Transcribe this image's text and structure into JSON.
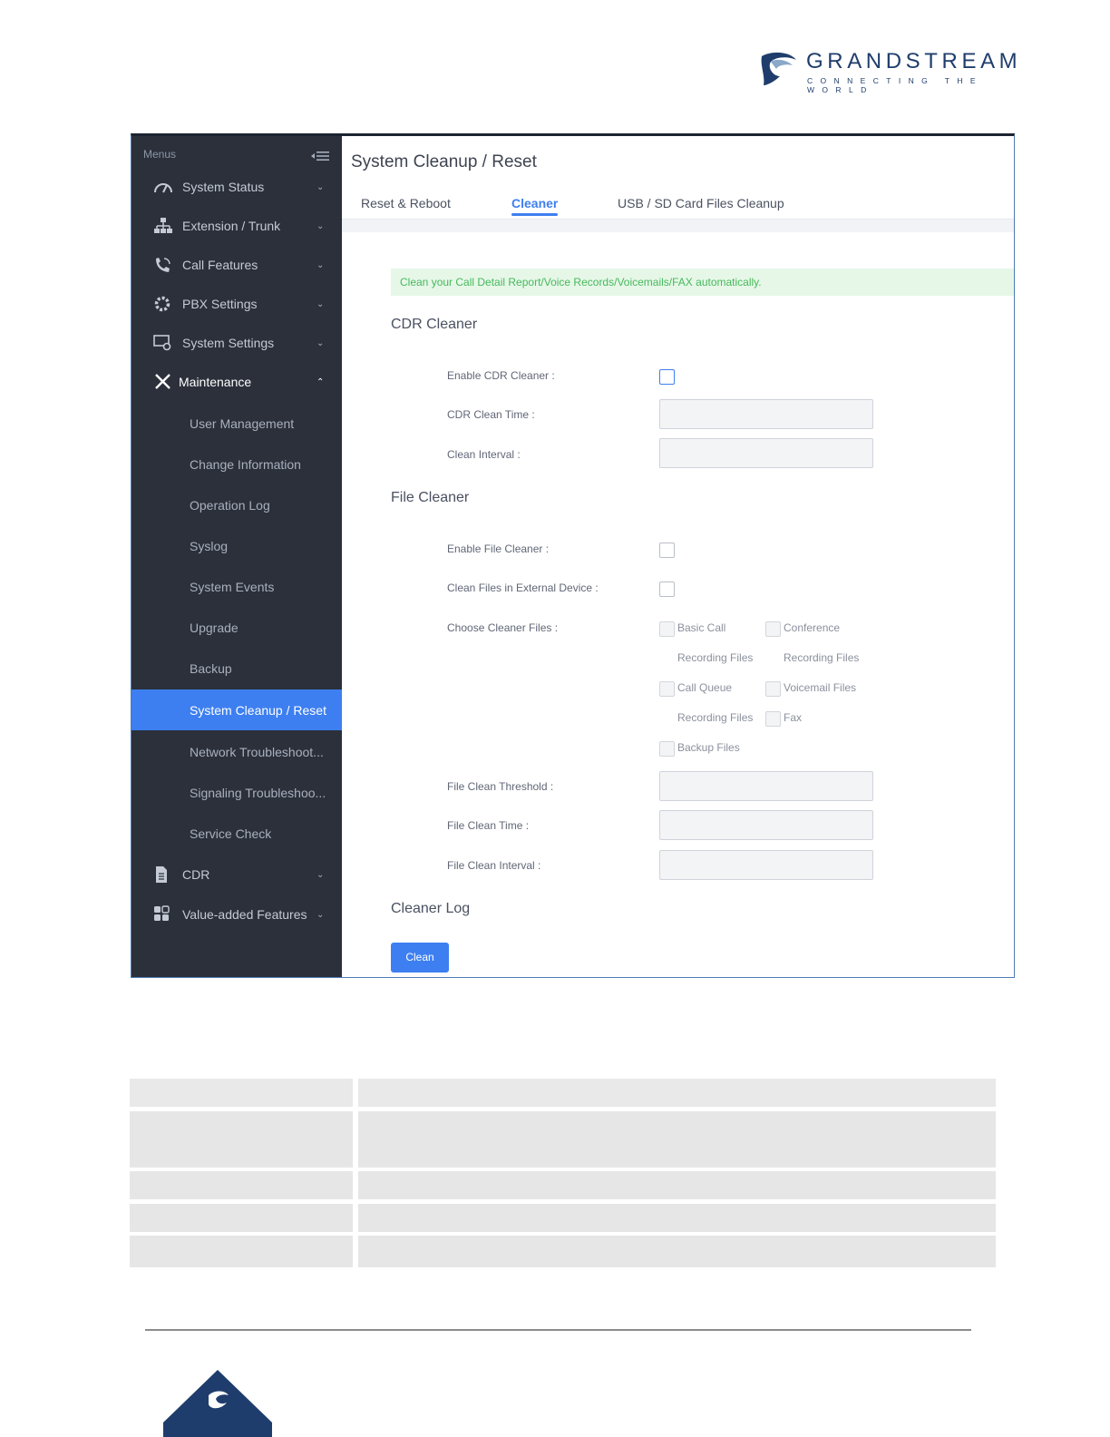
{
  "brand": {
    "name": "GRANDSTREAM",
    "tagline": "CONNECTING THE WORLD",
    "color": "#1f3d6c"
  },
  "sidebar": {
    "title": "Menus",
    "items": [
      {
        "label": "System Status",
        "icon": "gauge-icon"
      },
      {
        "label": "Extension / Trunk",
        "icon": "network-icon"
      },
      {
        "label": "Call Features",
        "icon": "phone-icon"
      },
      {
        "label": "PBX Settings",
        "icon": "gear-icon"
      },
      {
        "label": "System Settings",
        "icon": "monitor-gear-icon"
      },
      {
        "label": "Maintenance",
        "icon": "tools-icon"
      }
    ],
    "maintenance_subitems": [
      "User Management",
      "Change Information",
      "Operation Log",
      "Syslog",
      "System Events",
      "Upgrade",
      "Backup",
      "System Cleanup / Reset",
      "Network Troubleshoot...",
      "Signaling Troubleshoo...",
      "Service Check"
    ],
    "active_subitem": "System Cleanup / Reset",
    "bottom_items": [
      {
        "label": "CDR",
        "icon": "document-icon"
      },
      {
        "label": "Value-added Features",
        "icon": "apps-icon"
      }
    ]
  },
  "content": {
    "page_title": "System Cleanup / Reset",
    "tabs": [
      "Reset & Reboot",
      "Cleaner",
      "USB / SD Card Files Cleanup"
    ],
    "active_tab": "Cleaner",
    "notice": "Clean your Call Detail Report/Voice Records/Voicemails/FAX automatically.",
    "cdr_section": {
      "title": "CDR Cleaner",
      "enable_label": "Enable CDR Cleaner :",
      "time_label": "CDR Clean Time :",
      "interval_label": "Clean Interval :",
      "time_value": "",
      "interval_value": ""
    },
    "file_section": {
      "title": "File Cleaner",
      "enable_label": "Enable File Cleaner :",
      "external_label": "Clean Files in External Device :",
      "choose_label": "Choose Cleaner Files :",
      "options": {
        "basic_call_1": "Basic Call",
        "basic_call_2": "Recording Files",
        "conference_1": "Conference",
        "conference_2": "Recording Files",
        "call_queue_1": "Call Queue",
        "call_queue_2": "Recording Files",
        "voicemail": "Voicemail Files",
        "fax": "Fax",
        "backup": "Backup Files"
      },
      "threshold_label": "File Clean Threshold :",
      "time_label": "File Clean Time :",
      "interval_label": "File Clean Interval :"
    },
    "log_section": {
      "title": "Cleaner Log",
      "button": "Clean"
    }
  },
  "colors": {
    "accent": "#3d7ff0",
    "sidebar_bg": "#2b303b",
    "notice_bg": "#e6f7e8",
    "notice_text": "#48b95c"
  }
}
